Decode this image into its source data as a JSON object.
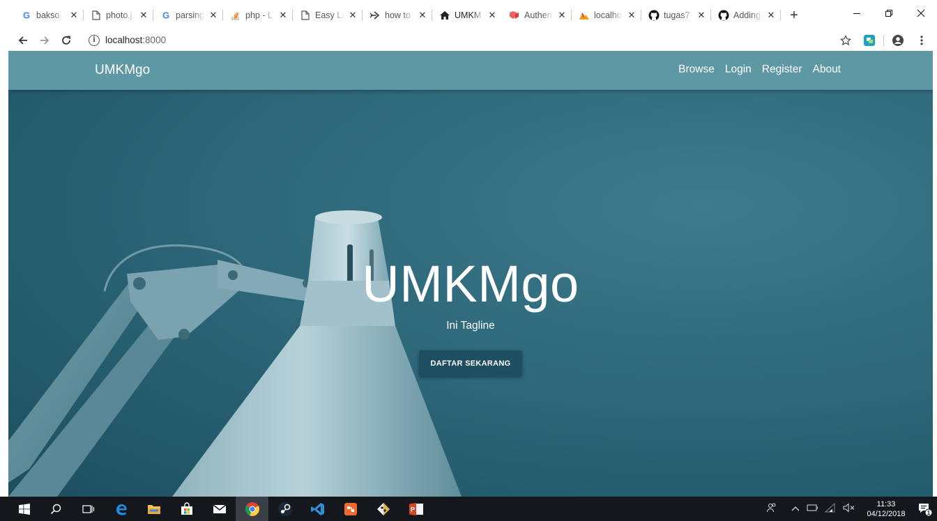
{
  "browser": {
    "tabs": [
      {
        "label": "bakso",
        "icon": "google-icon"
      },
      {
        "label": "photo.j",
        "icon": "page-icon"
      },
      {
        "label": "parsing",
        "icon": "google-icon"
      },
      {
        "label": "php - L",
        "icon": "stackoverflow-icon"
      },
      {
        "label": "Easy La",
        "icon": "page-icon"
      },
      {
        "label": "how to",
        "icon": "arrow-tab-icon"
      },
      {
        "label": "UMKM",
        "icon": "home-icon",
        "active": true
      },
      {
        "label": "Authen",
        "icon": "laravel-icon"
      },
      {
        "label": "localho",
        "icon": "xampp-icon"
      },
      {
        "label": "tugas7",
        "icon": "github-icon"
      },
      {
        "label": "Adding",
        "icon": "github-icon"
      }
    ],
    "close_glyph": "✕",
    "new_tab_glyph": "+",
    "url_host": "localhost",
    "url_port": ":8000"
  },
  "page": {
    "brand": "UMKMgo",
    "nav": [
      "Browse",
      "Login",
      "Register",
      "About"
    ],
    "hero_title": "UMKMgo",
    "hero_tagline": "Ini Tagline",
    "cta_label": "DAFTAR SEKARANG"
  },
  "taskbar": {
    "time": "11:33",
    "date": "04/12/2018",
    "notification_count": "1"
  },
  "colors": {
    "navbar": "#5f98a5",
    "hero": "#2f6a7c",
    "cta": "#1e4f61",
    "taskbar": "#14181d"
  }
}
